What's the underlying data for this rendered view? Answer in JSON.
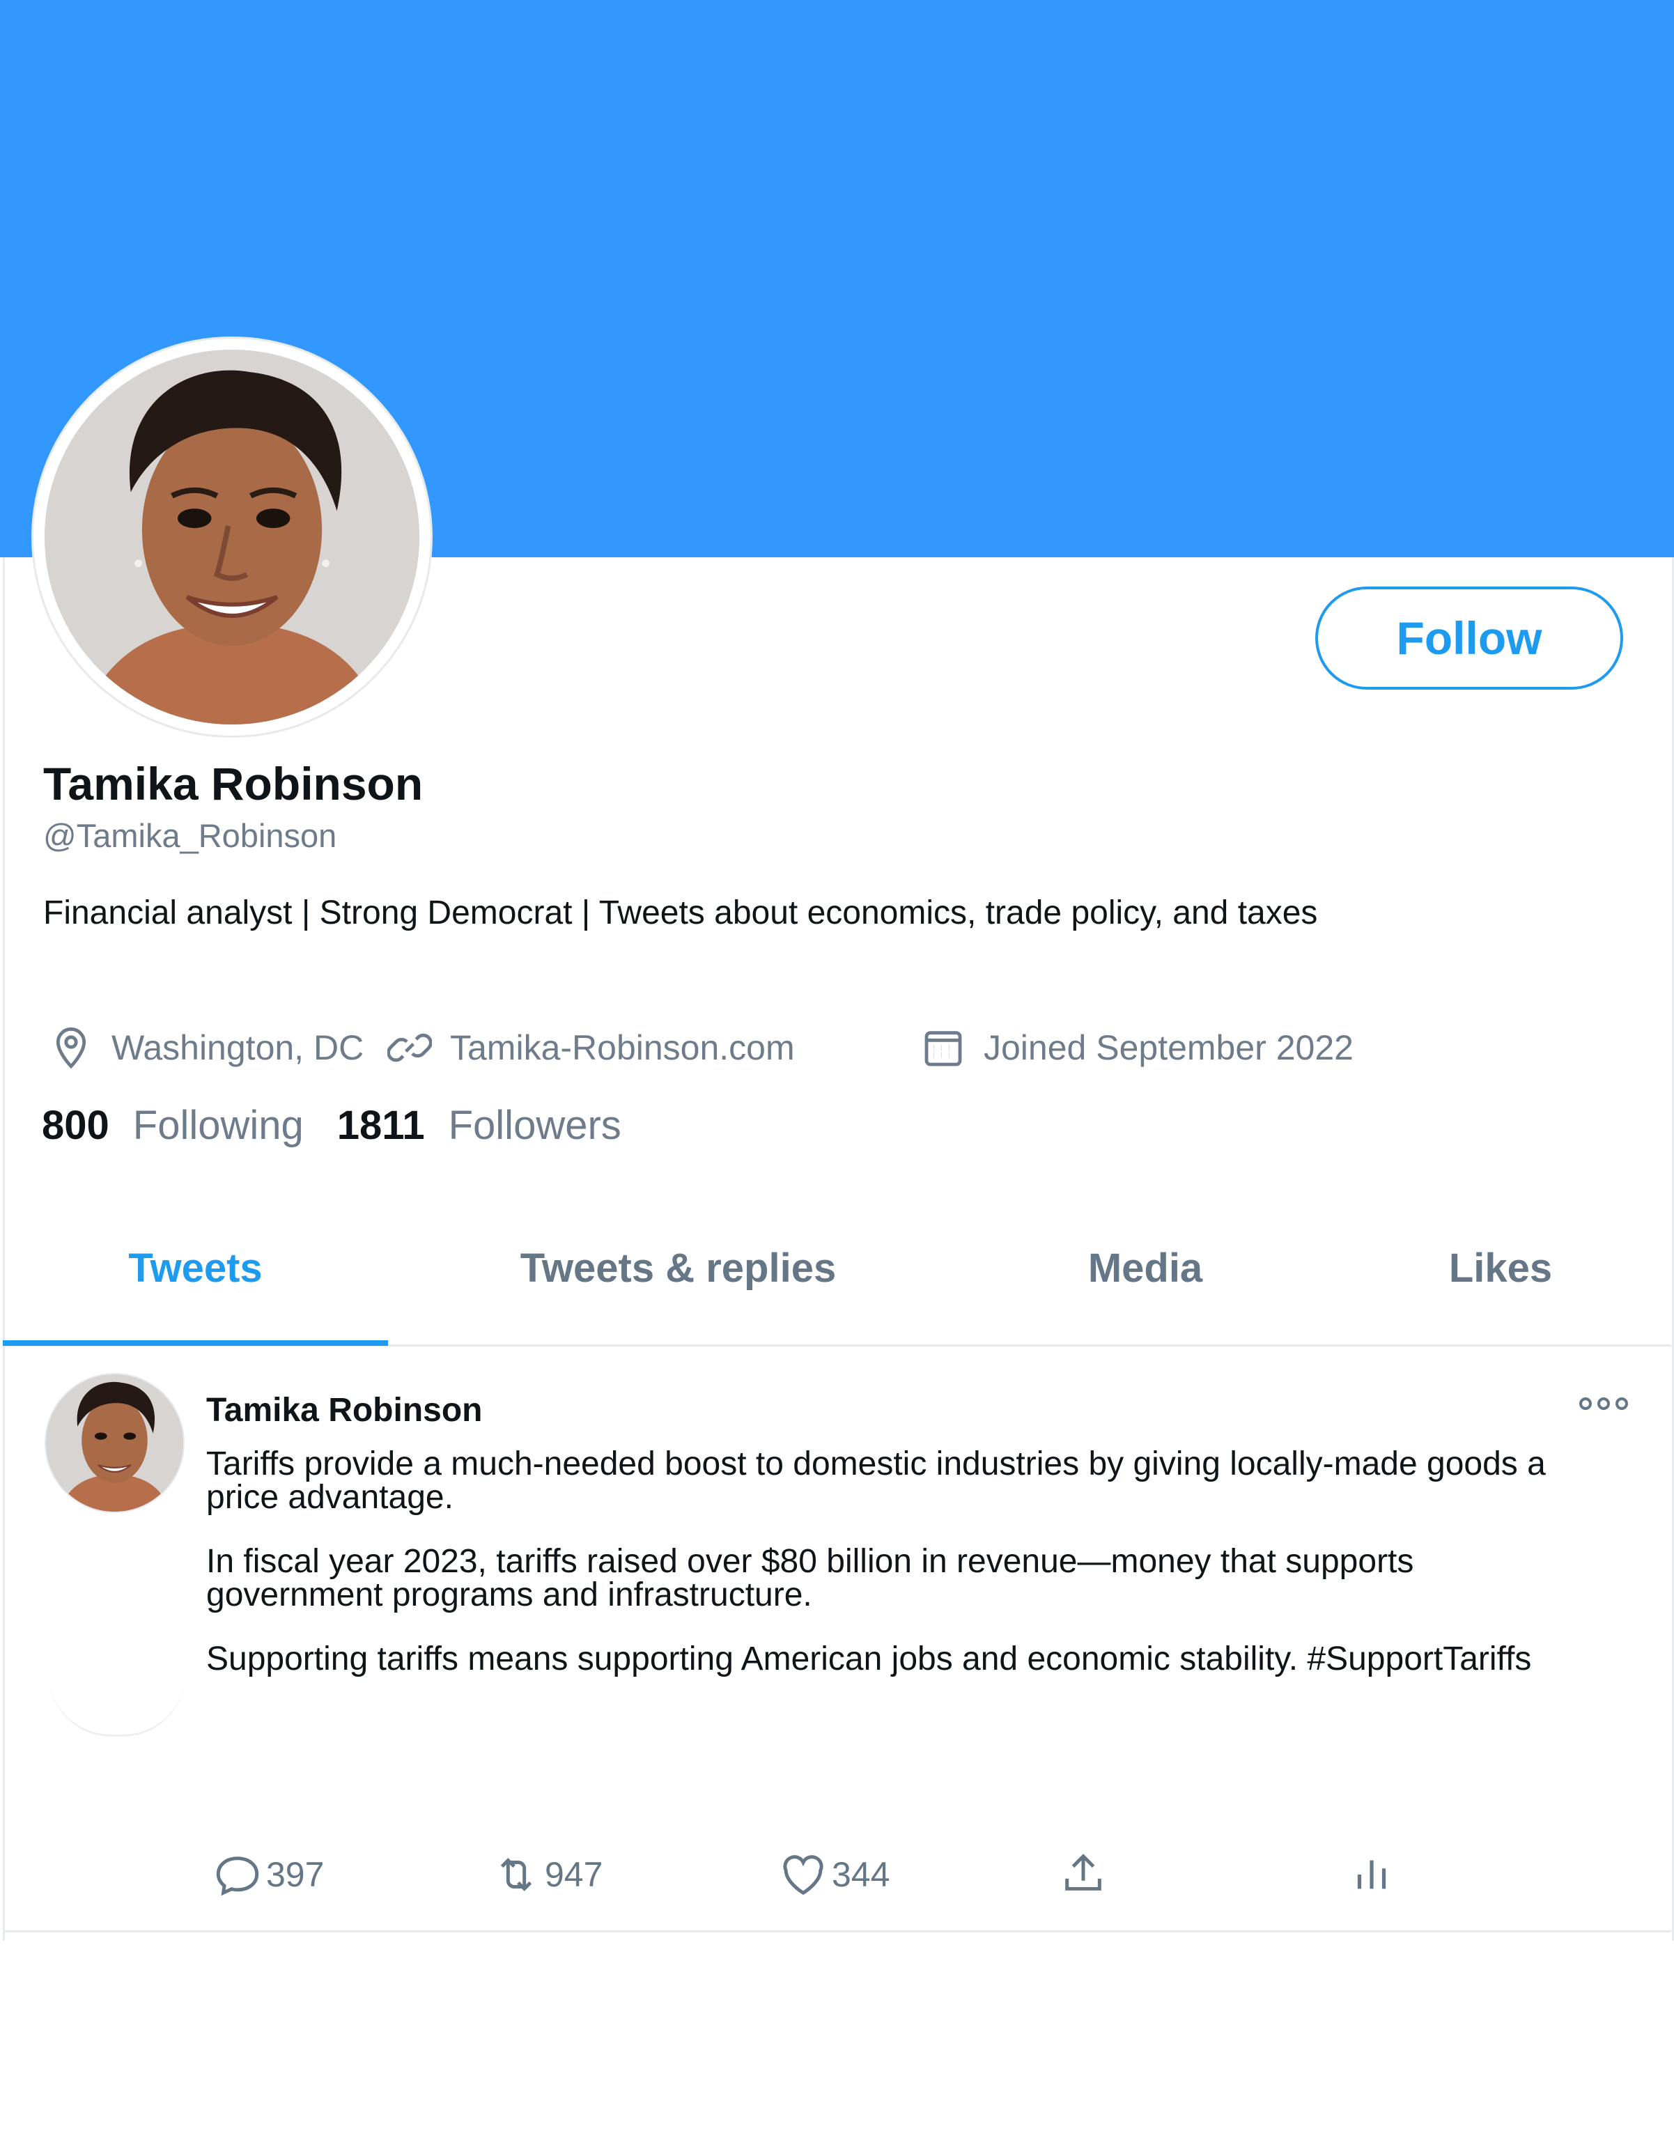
{
  "profile": {
    "name": "Tamika Robinson",
    "handle": "@Tamika_Robinson",
    "bio": "Financial analyst | Strong Democrat | Tweets about economics, trade policy, and taxes",
    "location": "Washington, DC",
    "website": "Tamika-Robinson.com",
    "joined": "Joined September 2022",
    "follow_label": "Follow",
    "following_count": "800",
    "following_label": "Following",
    "followers_count": "1811",
    "followers_label": "Followers"
  },
  "tabs": [
    {
      "label": "Tweets",
      "active": true
    },
    {
      "label": "Tweets & replies",
      "active": false
    },
    {
      "label": "Media",
      "active": false
    },
    {
      "label": "Likes",
      "active": false
    }
  ],
  "tweet": {
    "author": "Tamika Robinson",
    "paragraphs": [
      "Tariffs provide a much-needed boost to domestic industries by giving locally-made goods a price advantage.",
      "In fiscal year 2023, tariffs raised over $80 billion in revenue—money that supports government programs and infrastructure.",
      "Supporting tariffs means supporting American jobs and economic stability. #SupportTariffs"
    ],
    "replies": "397",
    "retweets": "947",
    "likes": "344"
  },
  "icons": {
    "location": "location-pin-icon",
    "website": "link-icon",
    "joined": "calendar-icon",
    "more": "more-options-icon",
    "reply": "reply-icon",
    "retweet": "retweet-icon",
    "like": "heart-icon",
    "share": "share-icon",
    "analytics": "analytics-icon"
  },
  "colors": {
    "banner": "#3398fe",
    "accent": "#1d9bf0",
    "muted_text": "#6d7b8a"
  }
}
